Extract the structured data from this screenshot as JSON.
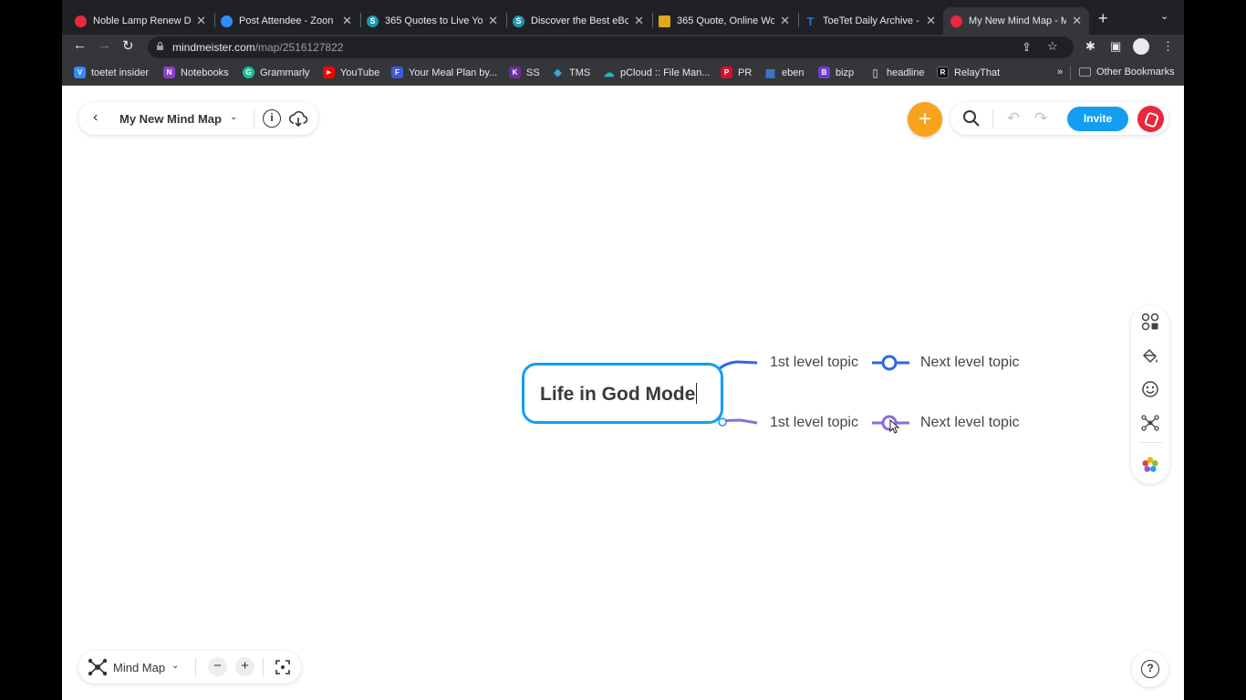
{
  "browser": {
    "tabs": [
      {
        "title": "Noble Lamp Renew D",
        "color": "#e8283f",
        "glyph": ""
      },
      {
        "title": "Post Attendee - Zoon",
        "color": "#2d8cff",
        "glyph": ""
      },
      {
        "title": "365 Quotes to Live Yo",
        "color": "#1a9ab0",
        "glyph": "S"
      },
      {
        "title": "Discover the Best eBo",
        "color": "#1a9ab0",
        "glyph": "S"
      },
      {
        "title": "365 Quote, Online Wo",
        "color": "#e0a81d",
        "glyph": ""
      },
      {
        "title": "ToeTet Daily Archive -",
        "color": "#2d6fd8",
        "glyph": "T"
      },
      {
        "title": "My New Mind Map - M",
        "color": "#e8283f",
        "glyph": ""
      }
    ],
    "url_host": "mindmeister.com",
    "url_path": "/map/2516127822",
    "bookmarks": [
      {
        "label": "toetet insider",
        "color": "#2d8cff",
        "glyph": "V"
      },
      {
        "label": "Notebooks",
        "color": "#8b3fd1",
        "glyph": "N"
      },
      {
        "label": "Grammarly",
        "color": "#15c39a",
        "glyph": "G"
      },
      {
        "label": "YouTube",
        "color": "#ff0000",
        "glyph": "▶"
      },
      {
        "label": "Your Meal Plan by...",
        "color": "#3b5bdb",
        "glyph": "F"
      },
      {
        "label": "SS",
        "color": "#6b2fa3",
        "glyph": "K"
      },
      {
        "label": "TMS",
        "color": "#3ba3e0",
        "glyph": "◆"
      },
      {
        "label": "pCloud :: File Man...",
        "color": "#17bed0",
        "glyph": "☁"
      },
      {
        "label": "PR",
        "color": "#d6102a",
        "glyph": "P"
      },
      {
        "label": "eben",
        "color": "#3b7ddb",
        "glyph": "▦"
      },
      {
        "label": "bizp",
        "color": "#6b3fd1",
        "glyph": "B"
      },
      {
        "label": "headline",
        "color": "#35363a",
        "glyph": "▯"
      },
      {
        "label": "RelayThat",
        "color": "#222222",
        "glyph": "R"
      }
    ],
    "bookmarks_overflow": "»",
    "other_bookmarks": "Other Bookmarks"
  },
  "app": {
    "map_title": "My New Mind Map",
    "invite_label": "Invite",
    "view_mode": "Mind Map",
    "accent": "#139ef3",
    "add_color": "#f7a31c"
  },
  "mindmap": {
    "root": "Life in God Mode",
    "branches": [
      {
        "topic": "1st level topic",
        "child": "Next level topic",
        "color": "#2f68e0"
      },
      {
        "topic": "1st level topic",
        "child": "Next level topic",
        "color": "#8c6be0"
      }
    ]
  },
  "icons": {
    "info": "i",
    "help": "?",
    "zoom_in": "+",
    "zoom_out": "−",
    "add": "+"
  }
}
